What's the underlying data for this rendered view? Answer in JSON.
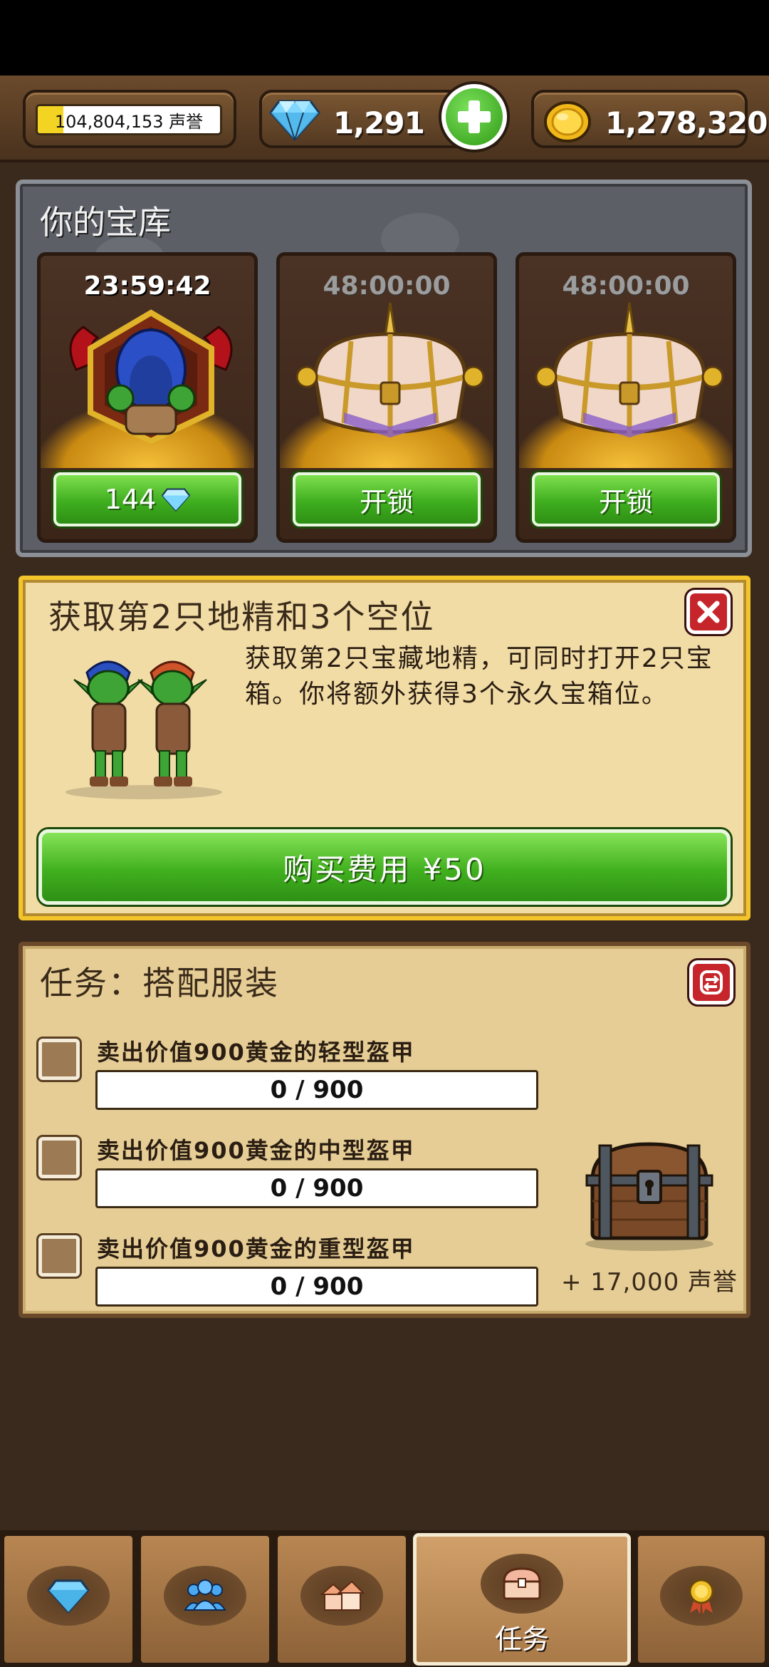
{
  "resources": {
    "fame": "104,804,153 声誉",
    "fame_progress": 0.14,
    "gems": "1,291",
    "gold": "1,278,320"
  },
  "vault": {
    "title": "你的宝库",
    "chests": [
      {
        "timer": "23:59:42",
        "button": "144",
        "type": "occupied-demon-chest",
        "active": true
      },
      {
        "timer": "48:00:00",
        "button": "开锁",
        "type": "unicorn-chest",
        "active": false
      },
      {
        "timer": "48:00:00",
        "button": "开锁",
        "type": "unicorn-chest",
        "active": false
      }
    ]
  },
  "offer": {
    "title": "获取第2只地精和3个空位",
    "description": "获取第2只宝藏地精，可同时打开2只宝箱。你将额外获得3个永久宝箱位。",
    "buy_label": "购买费用 ¥50"
  },
  "quest": {
    "title": "任务：搭配服装",
    "tasks": [
      {
        "label": "卖出价值900黄金的轻型盔甲",
        "progress": "0 / 900",
        "value": 0,
        "max": 900
      },
      {
        "label": "卖出价值900黄金的中型盔甲",
        "progress": "0 / 900",
        "value": 0,
        "max": 900
      },
      {
        "label": "卖出价值900黄金的重型盔甲",
        "progress": "0 / 900",
        "value": 0,
        "max": 900
      }
    ],
    "reward": "+ 17,000 声誉"
  },
  "nav": {
    "tabs": [
      {
        "icon": "gems-icon",
        "label": ""
      },
      {
        "icon": "workers-icon",
        "label": ""
      },
      {
        "icon": "town-icon",
        "label": ""
      },
      {
        "icon": "chest-icon",
        "label": "任务",
        "active": true
      },
      {
        "icon": "medal-icon",
        "label": ""
      }
    ]
  },
  "colors": {
    "accent_green": "#41b01e",
    "close_red": "#c6262b",
    "offer_border": "#f4c52a",
    "fame_fill": "#f4d423"
  }
}
